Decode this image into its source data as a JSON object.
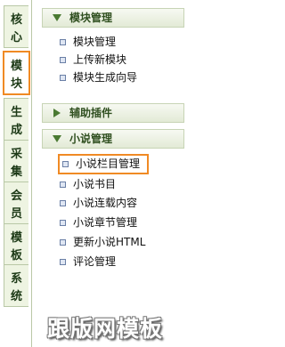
{
  "tabs": [
    {
      "label": "核心"
    },
    {
      "label": "模块",
      "active": true
    },
    {
      "label": "生成"
    },
    {
      "label": "采集"
    },
    {
      "label": "会员"
    },
    {
      "label": "模板"
    },
    {
      "label": "系统"
    }
  ],
  "sections": {
    "module_manage": {
      "title": "模块管理",
      "expanded": true,
      "items": [
        "模块管理",
        "上传新模块",
        "模块生成向导"
      ]
    },
    "plugins": {
      "title": "辅助插件",
      "expanded": false
    },
    "novel_manage": {
      "title": "小说管理",
      "expanded": true,
      "items": [
        "小说栏目管理",
        "小说书目",
        "小说连载内容",
        "小说章节管理",
        "更新小说HTML",
        "评论管理"
      ]
    }
  },
  "colors": {
    "highlight": "#f08a24",
    "section_text": "#2f4f1f",
    "tab_bg": "#eef4e2"
  },
  "watermark": "跟版网模板"
}
